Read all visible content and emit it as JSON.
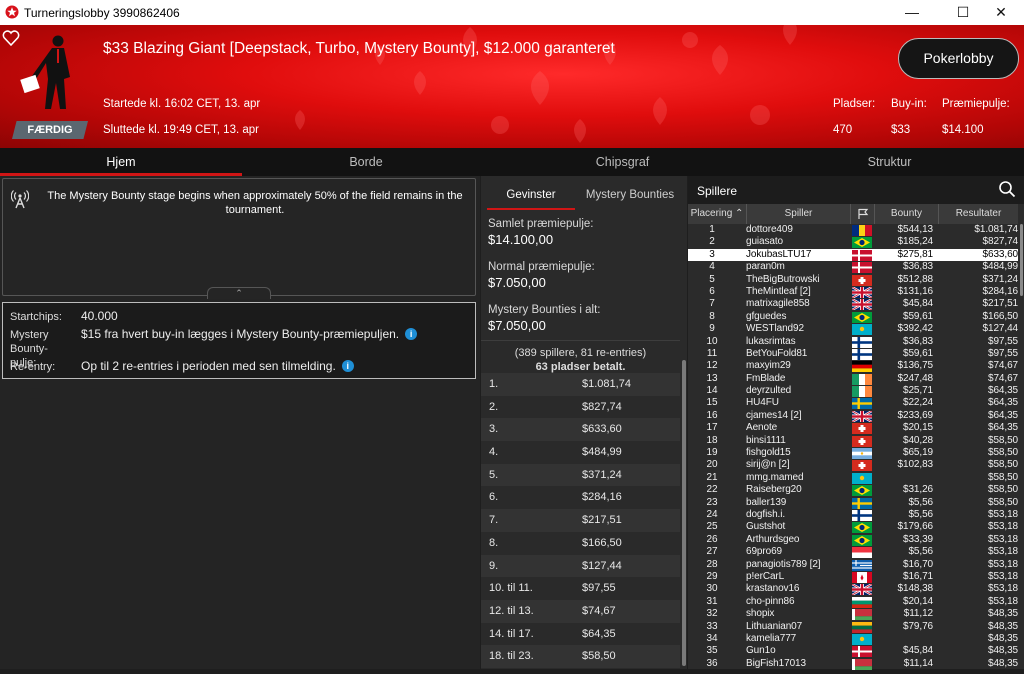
{
  "window": {
    "title": "Turneringslobby 3990862406"
  },
  "banner": {
    "title": "$33 Blazing Giant [Deepstack, Turbo, Mystery Bounty], $12.000 garanteret",
    "started": "Startede kl. 16:02 CET, 13. apr",
    "ended": "Sluttede kl. 19:49 CET, 13. apr",
    "status": "FÆRDIG",
    "lobby_button": "Pokerlobby",
    "stats": {
      "seats_label": "Pladser:",
      "seats": "470",
      "buyin_label": "Buy-in:",
      "buyin": "$33",
      "pool_label": "Præmiepulje:",
      "pool": "$14.100"
    }
  },
  "tabs": [
    "Hjem",
    "Borde",
    "Chipsgraf",
    "Struktur"
  ],
  "info": {
    "text": "The Mystery Bounty stage begins when approximately 50% of the field remains in the tournament."
  },
  "details": {
    "startchips_label": "Startchips:",
    "startchips": "40.000",
    "mb_label": "Mystery Bounty-pulje:",
    "mb_value": "$15 fra hvert buy-in lægges i Mystery Bounty-præmiepuljen.",
    "reentry_label": "Re-entry:",
    "reentry_value": "Op til 2 re-entries i perioden med sen tilmelding."
  },
  "prizes": {
    "tabs": [
      "Gevinster",
      "Mystery Bounties"
    ],
    "total_label": "Samlet præmiepulje:",
    "total": "$14.100,00",
    "normal_label": "Normal præmiepulje:",
    "normal": "$7.050,00",
    "mb_label": "Mystery Bounties i alt:",
    "mb": "$7.050,00",
    "players": "(389 spillere, 81 re-entries)",
    "paid": "63 pladser betalt.",
    "payouts": [
      [
        "1.",
        "$1.081,74"
      ],
      [
        "2.",
        "$827,74"
      ],
      [
        "3.",
        "$633,60"
      ],
      [
        "4.",
        "$484,99"
      ],
      [
        "5.",
        "$371,24"
      ],
      [
        "6.",
        "$284,16"
      ],
      [
        "7.",
        "$217,51"
      ],
      [
        "8.",
        "$166,50"
      ],
      [
        "9.",
        "$127,44"
      ],
      [
        "10. til 11.",
        "$97,55"
      ],
      [
        "12. til 13.",
        "$74,67"
      ],
      [
        "14. til 17.",
        "$64,35"
      ],
      [
        "18. til 23.",
        "$58,50"
      ]
    ]
  },
  "players_panel": {
    "title": "Spillere",
    "headers": {
      "place": "Placering",
      "player": "Spiller",
      "bounty": "Bounty",
      "result": "Resultater"
    },
    "rows": [
      [
        "1",
        "dottore409",
        "ro",
        "$544,13",
        "$1.081,74"
      ],
      [
        "2",
        "guiasato",
        "br",
        "$185,24",
        "$827,74"
      ],
      [
        "3",
        "JokubasLTU17",
        "dk",
        "$275,81",
        "$633,60"
      ],
      [
        "4",
        "paran0m",
        "dk",
        "$36,83",
        "$484,99"
      ],
      [
        "5",
        "TheBigButrowski",
        "ch",
        "$512,88",
        "$371,24"
      ],
      [
        "6",
        "TheMintleaf [2]",
        "gb",
        "$131,16",
        "$284,16"
      ],
      [
        "7",
        "matrixagile858",
        "gb",
        "$45,84",
        "$217,51"
      ],
      [
        "8",
        "gfguedes",
        "br",
        "$59,61",
        "$166,50"
      ],
      [
        "9",
        "WESTland92",
        "kz",
        "$392,42",
        "$127,44"
      ],
      [
        "10",
        "lukasrimtas",
        "fi",
        "$36,83",
        "$97,55"
      ],
      [
        "11",
        "BetYouFold81",
        "fi",
        "$59,61",
        "$97,55"
      ],
      [
        "12",
        "maxyim29",
        "de",
        "$136,75",
        "$74,67"
      ],
      [
        "13",
        "FmBlade",
        "ie",
        "$247,48",
        "$74,67"
      ],
      [
        "14",
        "deyrzulted",
        "ie",
        "$25,71",
        "$64,35"
      ],
      [
        "15",
        "HU4FU",
        "se",
        "$22,24",
        "$64,35"
      ],
      [
        "16",
        "cjames14 [2]",
        "gb",
        "$233,69",
        "$64,35"
      ],
      [
        "17",
        "Aenote",
        "ch",
        "$20,15",
        "$64,35"
      ],
      [
        "18",
        "binsi1111",
        "ch",
        "$40,28",
        "$58,50"
      ],
      [
        "19",
        "fishgold15",
        "ar",
        "$65,19",
        "$58,50"
      ],
      [
        "20",
        "sirij@n [2]",
        "ch",
        "$102,83",
        "$58,50"
      ],
      [
        "21",
        "mmg.mamed",
        "kz",
        "",
        "$58,50"
      ],
      [
        "22",
        "Raiseberg20",
        "br",
        "$31,26",
        "$58,50"
      ],
      [
        "23",
        "baller139",
        "se",
        "$5,56",
        "$58,50"
      ],
      [
        "24",
        "dogfish.i.",
        "fi",
        "$5,56",
        "$53,18"
      ],
      [
        "25",
        "Gustshot",
        "br",
        "$179,66",
        "$53,18"
      ],
      [
        "26",
        "Arthurdsgeo",
        "br",
        "$33,39",
        "$53,18"
      ],
      [
        "27",
        "69pro69",
        "sg",
        "$5,56",
        "$53,18"
      ],
      [
        "28",
        "panagiotis789 [2]",
        "gr",
        "$16,70",
        "$53,18"
      ],
      [
        "29",
        "p!erCarL",
        "ca",
        "$16,71",
        "$53,18"
      ],
      [
        "30",
        "krastanov16",
        "gb",
        "$148,38",
        "$53,18"
      ],
      [
        "31",
        "cho-pinn86",
        "bg",
        "$20,14",
        "$53,18"
      ],
      [
        "32",
        "shopix",
        "by",
        "$11,12",
        "$48,35"
      ],
      [
        "33",
        "Lithuanian07",
        "lt",
        "$79,76",
        "$48,35"
      ],
      [
        "34",
        "kamelia777",
        "kz",
        "",
        "$48,35"
      ],
      [
        "35",
        "Gun1o",
        "dk",
        "$45,84",
        "$48,35"
      ],
      [
        "36",
        "BigFish17013",
        "by",
        "$11,14",
        "$48,35"
      ]
    ]
  }
}
